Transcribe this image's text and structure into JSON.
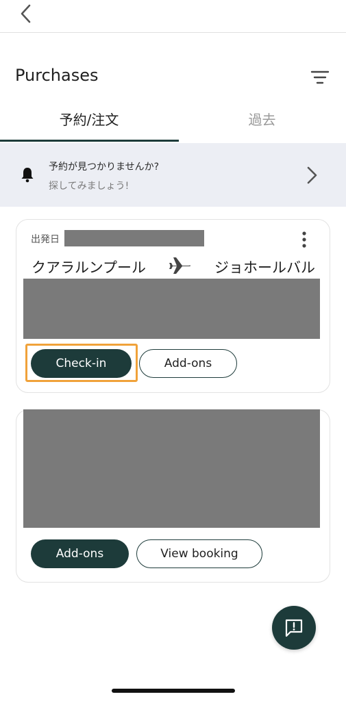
{
  "header": {
    "title": "Purchases"
  },
  "tabs": [
    {
      "label": "予約/注文",
      "active": true
    },
    {
      "label": "過去",
      "active": false
    }
  ],
  "banner": {
    "line1": "予約が見つかりませんか?",
    "line2": "探してみましょう!"
  },
  "bookings": [
    {
      "departure_label": "出発日",
      "origin": "クアラルンプール",
      "destination": "ジョホールバル",
      "buttons": [
        "Check-in",
        "Add-ons"
      ]
    },
    {
      "buttons": [
        "Add-ons",
        "View booking"
      ]
    }
  ],
  "colors": {
    "primary": "#1d3b3a",
    "highlight": "#f0a23a",
    "banner_bg": "#eceef4",
    "redaction": "#7a7a7a"
  },
  "icons": [
    "back-chevron-icon",
    "filter-icon",
    "bell-icon",
    "chevron-right-icon",
    "more-vert-icon",
    "airplane-icon",
    "feedback-icon"
  ]
}
